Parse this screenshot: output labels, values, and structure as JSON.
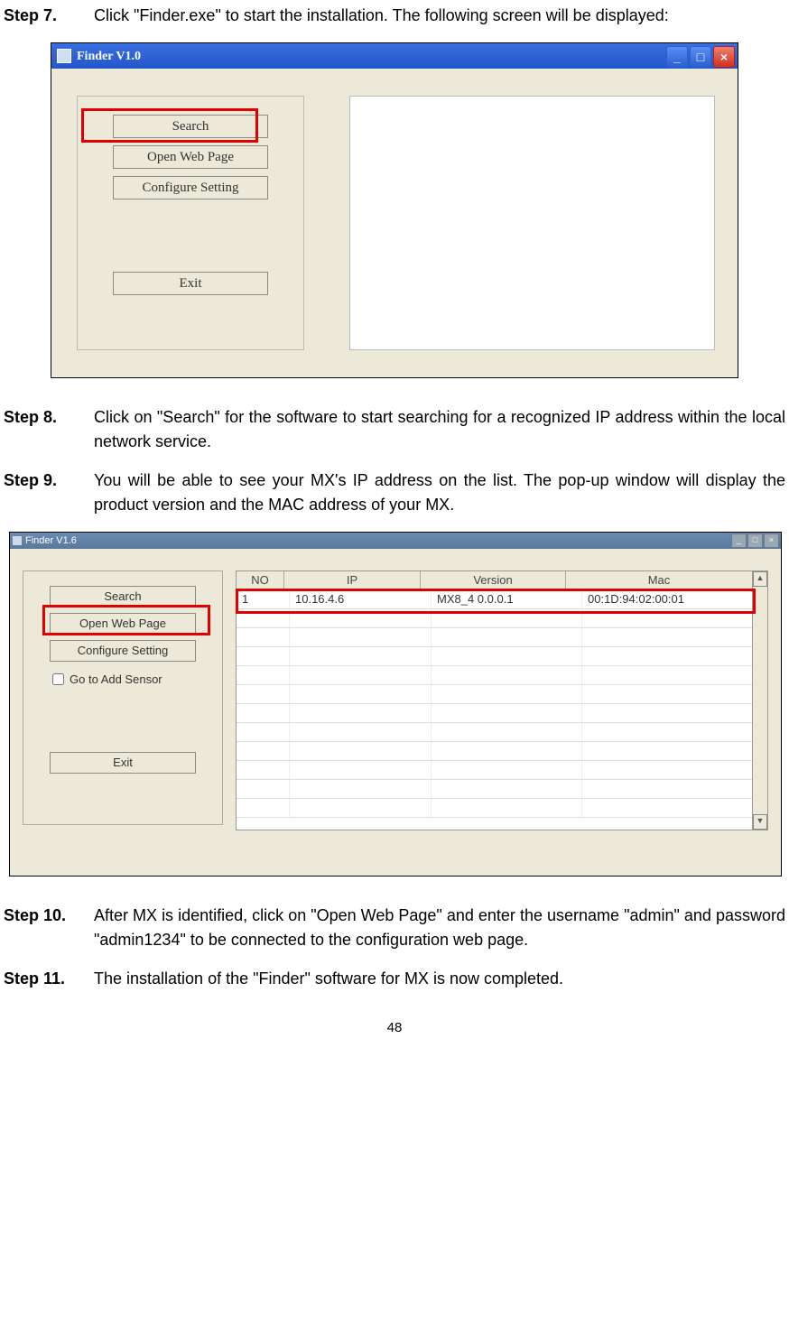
{
  "steps": {
    "s7": {
      "label": "Step 7.",
      "text": "Click \"Finder.exe\" to start the installation. The following screen will be displayed:"
    },
    "s8": {
      "label": "Step 8.",
      "text": "Click on \"Search\" for the software to start searching for a recognized IP address within the local network service."
    },
    "s9": {
      "label": "Step 9.",
      "text": "You will be able to see your MX's IP address on the list. The pop-up window will display the product version and the MAC address of your MX."
    },
    "s10": {
      "label": "Step 10.",
      "text": "After MX is identified, click on \"Open Web Page\" and enter the username \"admin\" and password \"admin1234\" to be connected to the configuration web page."
    },
    "s11": {
      "label": "Step 11.",
      "text": "The installation of the \"Finder\" software for MX is now completed."
    }
  },
  "fig1": {
    "title": "Finder V1.0",
    "buttons": {
      "search": "Search",
      "open": "Open Web Page",
      "conf": "Configure Setting",
      "exit": "Exit"
    }
  },
  "fig2": {
    "title": "Finder V1.6",
    "buttons": {
      "search": "Search",
      "open": "Open Web Page",
      "conf": "Configure Setting",
      "exit": "Exit"
    },
    "checkbox": "Go to Add Sensor",
    "headers": {
      "no": "NO",
      "ip": "IP",
      "ver": "Version",
      "mac": "Mac"
    },
    "row": {
      "no": "1",
      "ip": "10.16.4.6",
      "ver": "MX8_4   0.0.0.1",
      "mac": "00:1D:94:02:00:01"
    }
  },
  "page": "48"
}
